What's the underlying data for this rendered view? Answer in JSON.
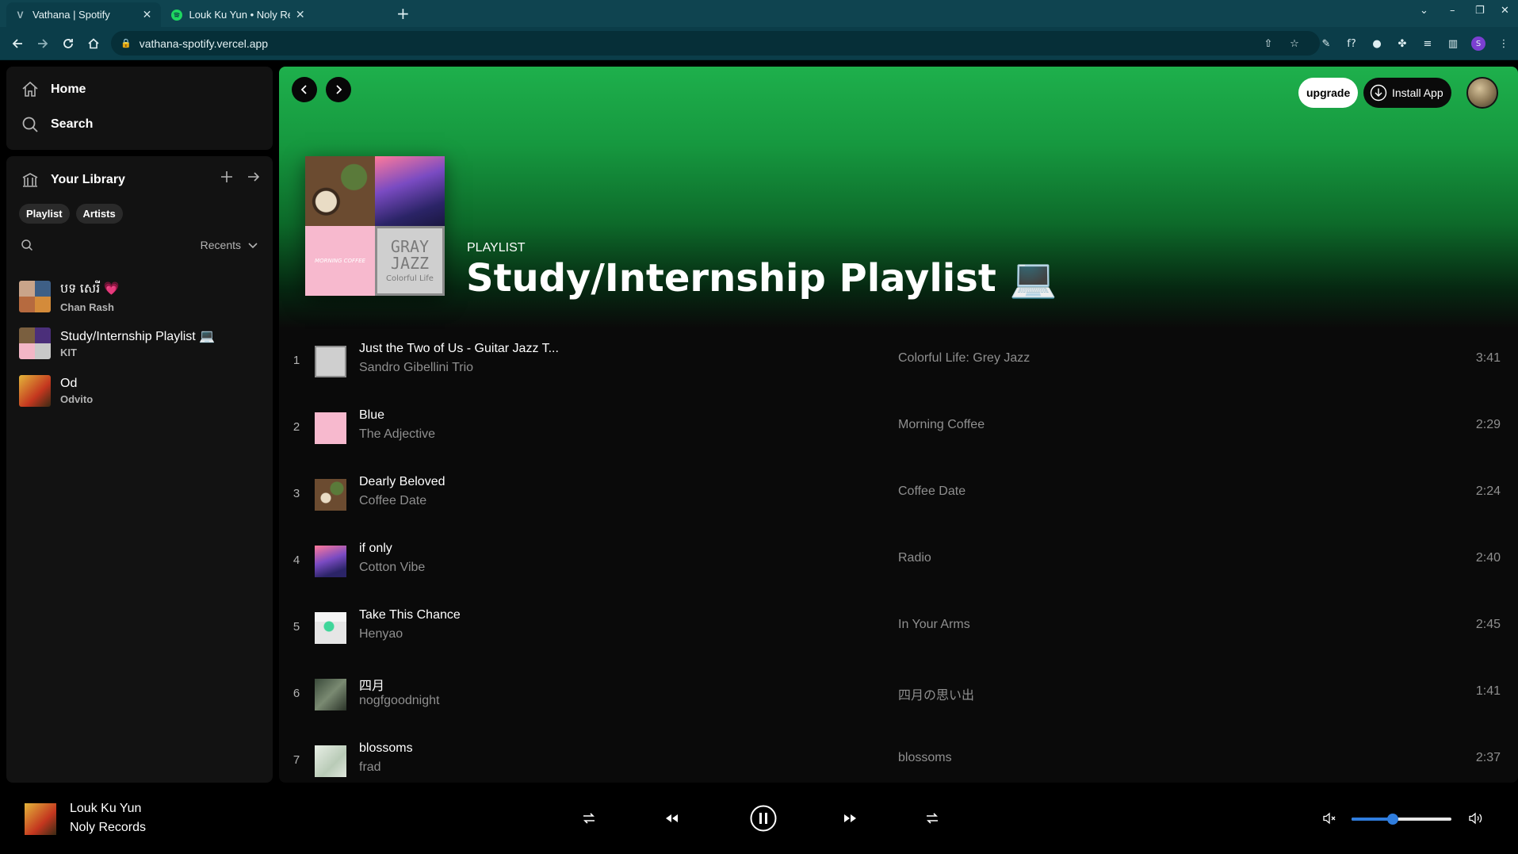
{
  "browser": {
    "tabs": [
      {
        "title": "Vathana | Spotify",
        "active": true
      },
      {
        "title": "Louk Ku Yun • Noly Records",
        "active": false
      }
    ],
    "url": "vathana-spotify.vercel.app"
  },
  "nav": {
    "home": "Home",
    "search": "Search"
  },
  "library": {
    "title": "Your Library",
    "chips": [
      "Playlist",
      "Artists"
    ],
    "sort_label": "Recents",
    "items": [
      {
        "title": "បទ សេរី 💗",
        "subtitle": "Chan Rash"
      },
      {
        "title": "Study/Internship Playlist 💻",
        "subtitle": "KIT"
      },
      {
        "title": "Od",
        "subtitle": "Odvito"
      }
    ]
  },
  "header": {
    "upgrade": "upgrade",
    "install": "Install App"
  },
  "cover": {
    "gray_jazz_line1": "GRAY",
    "gray_jazz_line2": "JAZZ",
    "gray_jazz_line3": "Colorful Life",
    "morning_coffee": "MORNING COFFEE"
  },
  "playlist": {
    "kind": "PLAYLIST",
    "title": "Study/Internship Playlist 💻",
    "tracks": [
      {
        "num": "1",
        "title": "Just the Two of Us - Guitar Jazz T...",
        "artist": "Sandro Gibellini Trio",
        "album": "Colorful Life: Grey Jazz",
        "duration": "3:41"
      },
      {
        "num": "2",
        "title": "Blue",
        "artist": "The Adjective",
        "album": "Morning Coffee",
        "duration": "2:29"
      },
      {
        "num": "3",
        "title": "Dearly Beloved",
        "artist": "Coffee Date",
        "album": "Coffee Date",
        "duration": "2:24"
      },
      {
        "num": "4",
        "title": "if only",
        "artist": "Cotton Vibe",
        "album": "Radio",
        "duration": "2:40"
      },
      {
        "num": "5",
        "title": "Take This Chance",
        "artist": "Henyao",
        "album": "In Your Arms",
        "duration": "2:45"
      },
      {
        "num": "6",
        "title": "四月",
        "artist": "nogfgoodnight",
        "album": "四月の思い出",
        "duration": "1:41"
      },
      {
        "num": "7",
        "title": "blossoms",
        "artist": "frad",
        "album": "blossoms",
        "duration": "2:37"
      }
    ]
  },
  "player": {
    "title": "Louk Ku Yun",
    "artist": "Noly Records",
    "state": "playing",
    "volume_fraction": 0.41
  },
  "colors": {
    "brand": "#1db954",
    "accent": "#2f7dde",
    "background": "#121212"
  }
}
